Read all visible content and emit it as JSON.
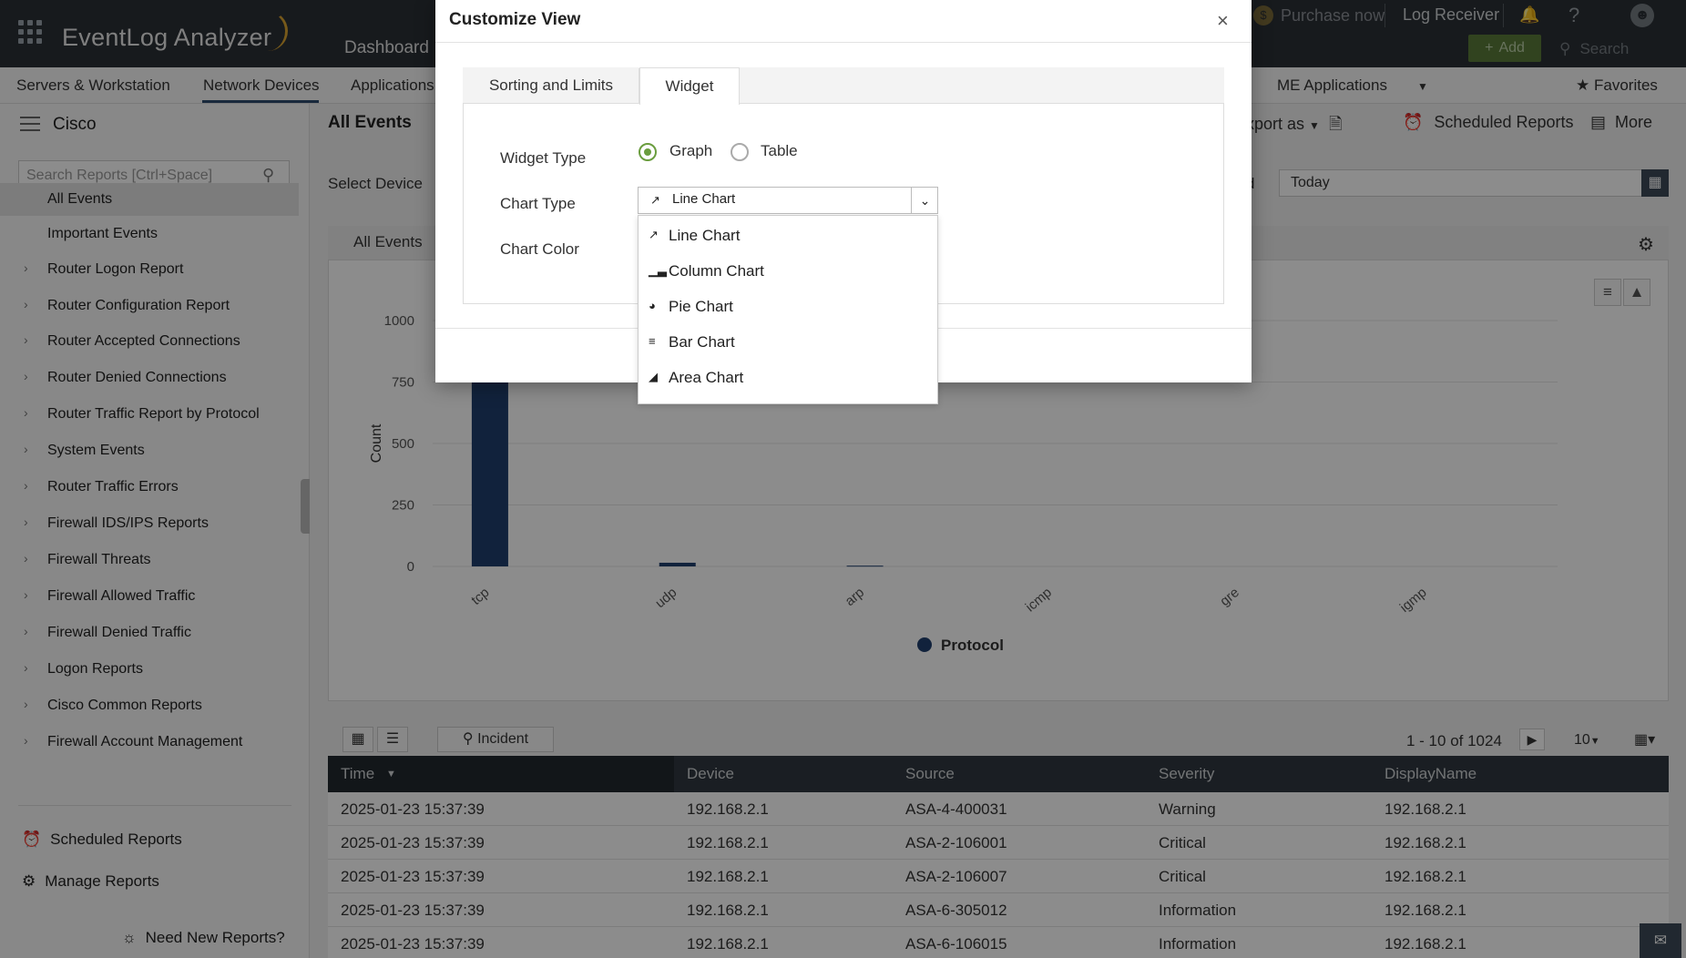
{
  "app": {
    "name": "EventLog Analyzer",
    "nav_dashboard": "Dashboard",
    "purchase": "Purchase now",
    "log_receiver": "Log Receiver",
    "help": "?",
    "add": "Add",
    "search": "Search"
  },
  "tabs": [
    "Servers & Workstation",
    "Network Devices",
    "Applications",
    "ME Applications"
  ],
  "favorites": "Favorites",
  "sidebar": {
    "title": "Cisco",
    "search_placeholder": "Search Reports [Ctrl+Space]",
    "items": [
      {
        "label": "All Events"
      },
      {
        "label": "Important Events"
      },
      {
        "label": "Router Logon Report"
      },
      {
        "label": "Router Configuration Report"
      },
      {
        "label": "Router Accepted Connections"
      },
      {
        "label": "Router Denied Connections"
      },
      {
        "label": "Router Traffic Report by Protocol"
      },
      {
        "label": "System Events"
      },
      {
        "label": "Router Traffic Errors"
      },
      {
        "label": "Firewall IDS/IPS Reports"
      },
      {
        "label": "Firewall Threats"
      },
      {
        "label": "Firewall Allowed Traffic"
      },
      {
        "label": "Firewall Denied Traffic"
      },
      {
        "label": "Logon Reports"
      },
      {
        "label": "Cisco Common Reports"
      },
      {
        "label": "Firewall Account Management"
      }
    ],
    "scheduled_reports": "Scheduled Reports",
    "manage_reports": "Manage Reports",
    "need_new": "Need New Reports?"
  },
  "main": {
    "title": "All Events",
    "export": "xport as",
    "scheduled_reports": "Scheduled Reports",
    "more": "More",
    "select_device": "Select Device",
    "period_label": "d",
    "period_value": "Today",
    "chart_tab": "All Events"
  },
  "chart_data": {
    "type": "bar",
    "categories": [
      "tcp",
      "udp",
      "arp",
      "icmp",
      "gre",
      "igmp"
    ],
    "series": [
      {
        "name": "Protocol",
        "values": [
          1000,
          15,
          3,
          0,
          0,
          0
        ]
      }
    ],
    "ylabel": "Count",
    "yticks": [
      0,
      250,
      500,
      750,
      1000
    ],
    "ylim": [
      0,
      1000
    ],
    "color": "#1f3e6e",
    "legend": "bottom"
  },
  "table": {
    "incident": "Incident",
    "pager": "1 - 10 of 1024",
    "page_size": "10",
    "columns": [
      "Time",
      "Device",
      "Source",
      "Severity",
      "DisplayName"
    ],
    "rows": [
      [
        "2025-01-23 15:37:39",
        "192.168.2.1",
        "ASA-4-400031",
        "Warning",
        "192.168.2.1"
      ],
      [
        "2025-01-23 15:37:39",
        "192.168.2.1",
        "ASA-2-106001",
        "Critical",
        "192.168.2.1"
      ],
      [
        "2025-01-23 15:37:39",
        "192.168.2.1",
        "ASA-2-106007",
        "Critical",
        "192.168.2.1"
      ],
      [
        "2025-01-23 15:37:39",
        "192.168.2.1",
        "ASA-6-305012",
        "Information",
        "192.168.2.1"
      ],
      [
        "2025-01-23 15:37:39",
        "192.168.2.1",
        "ASA-6-106015",
        "Information",
        "192.168.2.1"
      ]
    ]
  },
  "modal": {
    "title": "Customize View",
    "tab_sorting": "Sorting and Limits",
    "tab_widget": "Widget",
    "widget_type_label": "Widget Type",
    "graph": "Graph",
    "table": "Table",
    "chart_type_label": "Chart Type",
    "chart_type_value": "Line Chart",
    "chart_color_label": "Chart Color",
    "options": [
      "Line Chart",
      "Column Chart",
      "Pie Chart",
      "Bar Chart",
      "Area Chart"
    ]
  }
}
